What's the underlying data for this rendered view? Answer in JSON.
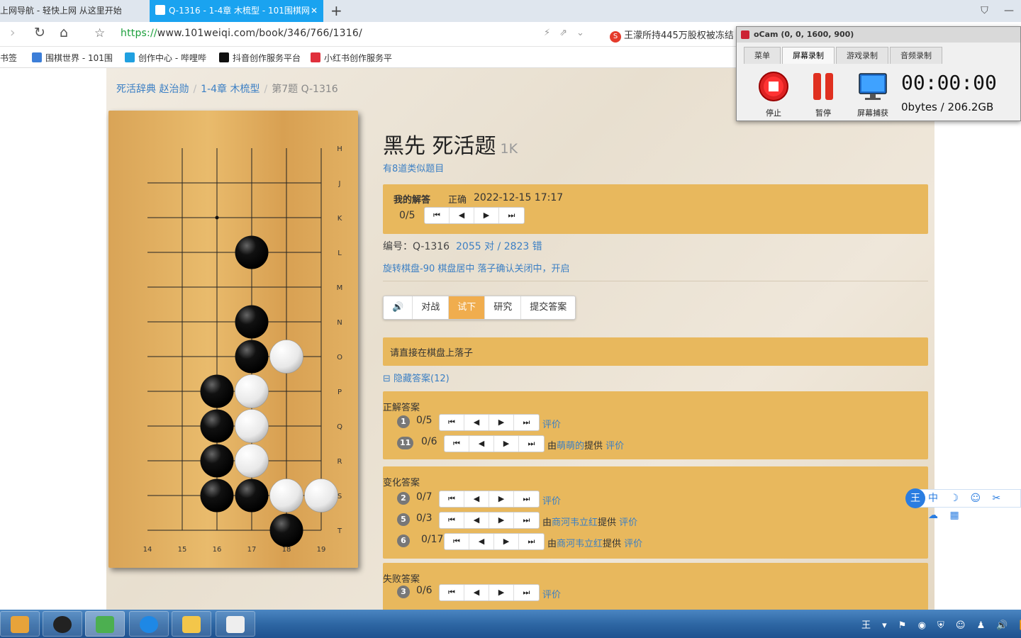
{
  "browser": {
    "tabs": [
      {
        "label": "上网导航 - 轻快上网 从这里开始",
        "active": false
      },
      {
        "label": "Q-1316 - 1-4章 木梳型 - 101围棋网",
        "active": true
      }
    ],
    "new_tab": "+",
    "url_proto": "https://",
    "url_rest": "www.101weiqi.com/book/346/766/1316/",
    "news_ticker": "王濛所持445万股权被冻结",
    "bookmarks": [
      {
        "label": "书签",
        "color": ""
      },
      {
        "label": "围棋世界 - 101围",
        "color": "#3c7ed8"
      },
      {
        "label": "创作中心 - 哔哩哔",
        "color": "#20a0e0"
      },
      {
        "label": "抖音创作服务平台",
        "color": "#111111"
      },
      {
        "label": "小红书创作服务平",
        "color": "#e0303c"
      }
    ]
  },
  "breadcrumb": {
    "items": [
      "死活辞典 赵治勋",
      "1-4章 木梳型",
      "第7题 Q-1316"
    ],
    "sep": "/"
  },
  "problem": {
    "title": "黑先 死活题",
    "level": "1K",
    "similar": "有8道类似题目",
    "my_answer_label": "我的解答",
    "result": "正确",
    "time": "2022-12-15 17:17",
    "counter": "0/5",
    "id_label": "编号：Q-1316",
    "stats": "2055 对 / 2823 错",
    "options": "旋转棋盘-90 棋盘居中  落子确认关闭中，开启",
    "modes": [
      "🔊",
      "对战",
      "试下",
      "研究",
      "提交答案"
    ],
    "active_mode": "试下",
    "hint": "请直接在棋盘上落子",
    "toggle": "⊟ 隐藏答案(12)"
  },
  "answers": {
    "correct_title": "正解答案",
    "variation_title": "变化答案",
    "fail_title": "失败答案",
    "rate": "评价",
    "by": "由",
    "provided": "提供",
    "correct": [
      {
        "num": "1",
        "count": "0/5",
        "author": ""
      },
      {
        "num": "11",
        "count": "0/6",
        "author": "萌萌的"
      }
    ],
    "variation": [
      {
        "num": "2",
        "count": "0/7",
        "author": ""
      },
      {
        "num": "5",
        "count": "0/3",
        "author": "商河韦立红"
      },
      {
        "num": "6",
        "count": "0/17",
        "author": "商河韦立红"
      }
    ],
    "fail": [
      {
        "num": "3",
        "count": "0/6",
        "author": ""
      }
    ]
  },
  "nav_buttons": [
    "⏮",
    "◀",
    "▶",
    "⏭"
  ],
  "board": {
    "col_labels": [
      "14",
      "15",
      "16",
      "17",
      "18",
      "19"
    ],
    "row_labels": [
      "H",
      "J",
      "K",
      "L",
      "M",
      "N",
      "O",
      "P",
      "Q",
      "R",
      "S",
      "T"
    ],
    "black_stones": [
      [
        17,
        "L"
      ],
      [
        17,
        "N"
      ],
      [
        17,
        "O"
      ],
      [
        16,
        "P"
      ],
      [
        16,
        "Q"
      ],
      [
        16,
        "R"
      ],
      [
        16,
        "S"
      ],
      [
        17,
        "S"
      ],
      [
        18,
        "T"
      ]
    ],
    "white_stones": [
      [
        18,
        "O"
      ],
      [
        17,
        "P"
      ],
      [
        17,
        "Q"
      ],
      [
        17,
        "R"
      ],
      [
        18,
        "S"
      ],
      [
        19,
        "S"
      ]
    ],
    "star_point": [
      16,
      "K"
    ]
  },
  "ocam": {
    "title": "oCam (0, 0, 1600, 900)",
    "tabs": [
      "菜单",
      "屏幕录制",
      "游戏录制",
      "音频录制"
    ],
    "active_tab": "屏幕录制",
    "stop": "停止",
    "pause": "暂停",
    "capture": "屏幕捕获",
    "timer": "00:00:00",
    "size": "0bytes / 206.2GB"
  },
  "ime": {
    "logo": "王",
    "items": "中 ☽ ☺ ✂ ☁ ▦"
  },
  "tray": "王 ▾ ⚑ ◉ ⛨ ☺ ♟ 🔊 📶"
}
